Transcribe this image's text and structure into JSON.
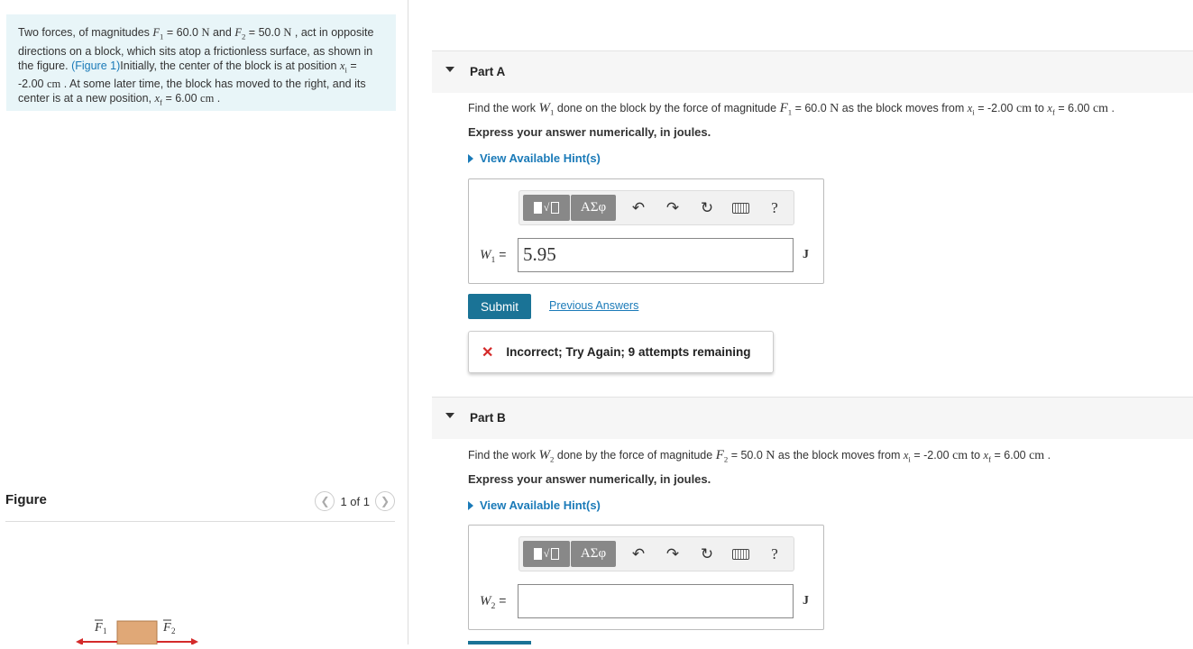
{
  "problem": {
    "text_1": "Two forces, of magnitudes ",
    "F1": "F",
    "F1_sub": "1",
    "F1_val": " = 60.0 ",
    "unit_N": "N",
    "and": " and ",
    "F2": "F",
    "F2_sub": "2",
    "F2_val": " = 50.0 ",
    "text_2": " , act in opposite directions on a block, which sits atop a frictionless surface, as shown in the figure. ",
    "figure_link": "(Figure 1)",
    "text_3": "Initially, the center of the block is at position ",
    "xi": "x",
    "xi_sub": "i",
    "xi_val": " = -2.00 ",
    "unit_cm": "cm",
    "text_4": " . At some later time, the block has moved to the right, and its center is at a new position, ",
    "xf": "x",
    "xf_sub": "f",
    "xf_val": " = 6.00 ",
    "end": " ."
  },
  "figure": {
    "title": "Figure",
    "page": "1 of 1",
    "prev_icon": "chevron-left-icon",
    "next_icon": "chevron-right-icon",
    "label_F1": "F",
    "label_F1_sub": "1",
    "label_F2": "F",
    "label_F2_sub": "2",
    "arrow_color": "#d42a2a",
    "block_color": "#e0a877"
  },
  "toolbar": {
    "templates_icon": "templates-icon",
    "greek_label": "ΑΣφ",
    "undo": "↶",
    "redo": "↷",
    "reset": "↻",
    "keyboard_icon": "keyboard-icon",
    "help": "?"
  },
  "partA": {
    "title": "Part A",
    "q_1": "Find the work ",
    "W": "W",
    "W_sub": "1",
    "q_2": " done on the block by the force of magnitude ",
    "F": "F",
    "F_sub": "1",
    "F_val": " = 60.0 ",
    "unit_N": "N",
    "q_3": " as the block moves from ",
    "xi": "x",
    "xi_sub": "i",
    "xi_val": " = -2.00 ",
    "unit_cm": "cm",
    "to": " to ",
    "xf": "x",
    "xf_sub": "f",
    "xf_val": " = 6.00 ",
    "end": " .",
    "express": "Express your answer numerically, in joules.",
    "hint": "View Available Hint(s)",
    "var": "W",
    "var_sub": "1",
    "eq": " =",
    "answer": "5.95",
    "unit": "J",
    "submit": "Submit",
    "previous": "Previous Answers",
    "feedback_icon": "✕",
    "feedback": "Incorrect; Try Again; 9 attempts remaining",
    "accent": "#1a7396"
  },
  "partB": {
    "title": "Part B",
    "q_1": "Find the work ",
    "W": "W",
    "W_sub": "2",
    "q_2": " done by the force of magnitude ",
    "F": "F",
    "F_sub": "2",
    "F_val": " = 50.0 ",
    "unit_N": "N",
    "q_3": " as the block moves from ",
    "xi": "x",
    "xi_sub": "i",
    "xi_val": " = -2.00 ",
    "unit_cm": "cm",
    "to": " to ",
    "xf": "x",
    "xf_sub": "f",
    "xf_val": " = 6.00 ",
    "end": " .",
    "express": "Express your answer numerically, in joules.",
    "hint": "View Available Hint(s)",
    "var": "W",
    "var_sub": "2",
    "eq": " =",
    "answer": "",
    "unit": "J"
  }
}
